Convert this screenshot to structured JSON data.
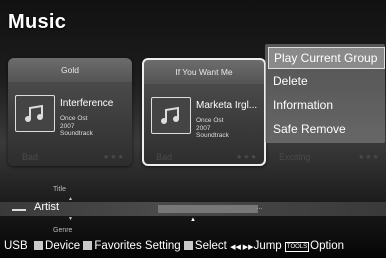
{
  "page": {
    "title": "Music"
  },
  "cards": [
    {
      "header": "Gold",
      "song": "Interference",
      "meta_line1": "Once Ost",
      "meta_line2": "2007",
      "meta_line3": "Soundtrack",
      "reflection": "Bad"
    },
    {
      "header": "If You Want Me",
      "song": "Marketa Irgl...",
      "meta_line1": "Once Ost",
      "meta_line2": "2007",
      "meta_line3": "Soundtrack",
      "reflection": "Bad"
    }
  ],
  "third_reflection": "Exciting",
  "stars": "★★★",
  "menu": {
    "items": [
      "Play Current Group",
      "Delete",
      "Information",
      "Safe Remove"
    ]
  },
  "sort": {
    "above": "Title",
    "current": "Artist",
    "below": "Genre",
    "dots": "..."
  },
  "footer": {
    "source": "USB",
    "device": "Device",
    "favorites": "Favorites Setting",
    "select": "Select",
    "jump_symbol": "◀◀ ▶▶",
    "jump": "Jump",
    "tools": "TOOLS",
    "option": "Option"
  },
  "icons": [
    "music-note-icon",
    "up-arrow-icon",
    "down-arrow-icon",
    "pointer-icon"
  ]
}
